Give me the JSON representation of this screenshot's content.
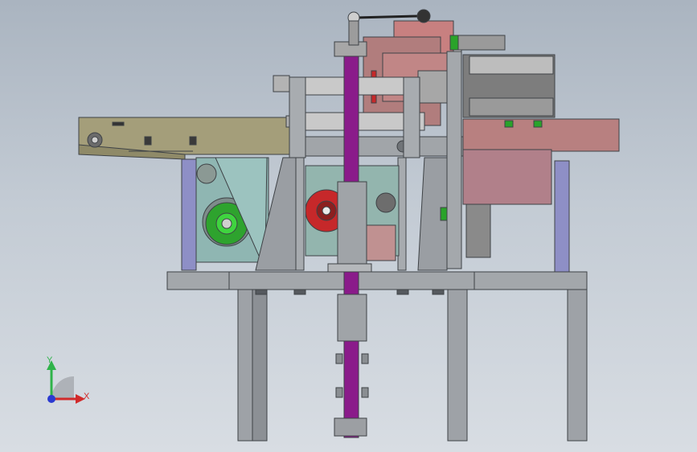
{
  "viewport": {
    "model": "machine-assembly-front-view",
    "colors": {
      "frame_grey": "#9aa0a6",
      "frame_edge": "#4a4e52",
      "conveyor_olive": "#a59f7a",
      "purple_rod": "#8a1c8a",
      "green_part": "#2aa32a",
      "red_part": "#c6282a",
      "pink_block": "#b87f7f",
      "lavender_post": "#8f8fc9",
      "teal_housing": "#8fb7b3",
      "dark_housing": "#7d7d7d"
    }
  },
  "triad": {
    "y_label": "Y",
    "x_label": "X",
    "y_color": "#2fb34a",
    "x_color": "#d12a2a",
    "origin_color": "#2a3ad1"
  }
}
